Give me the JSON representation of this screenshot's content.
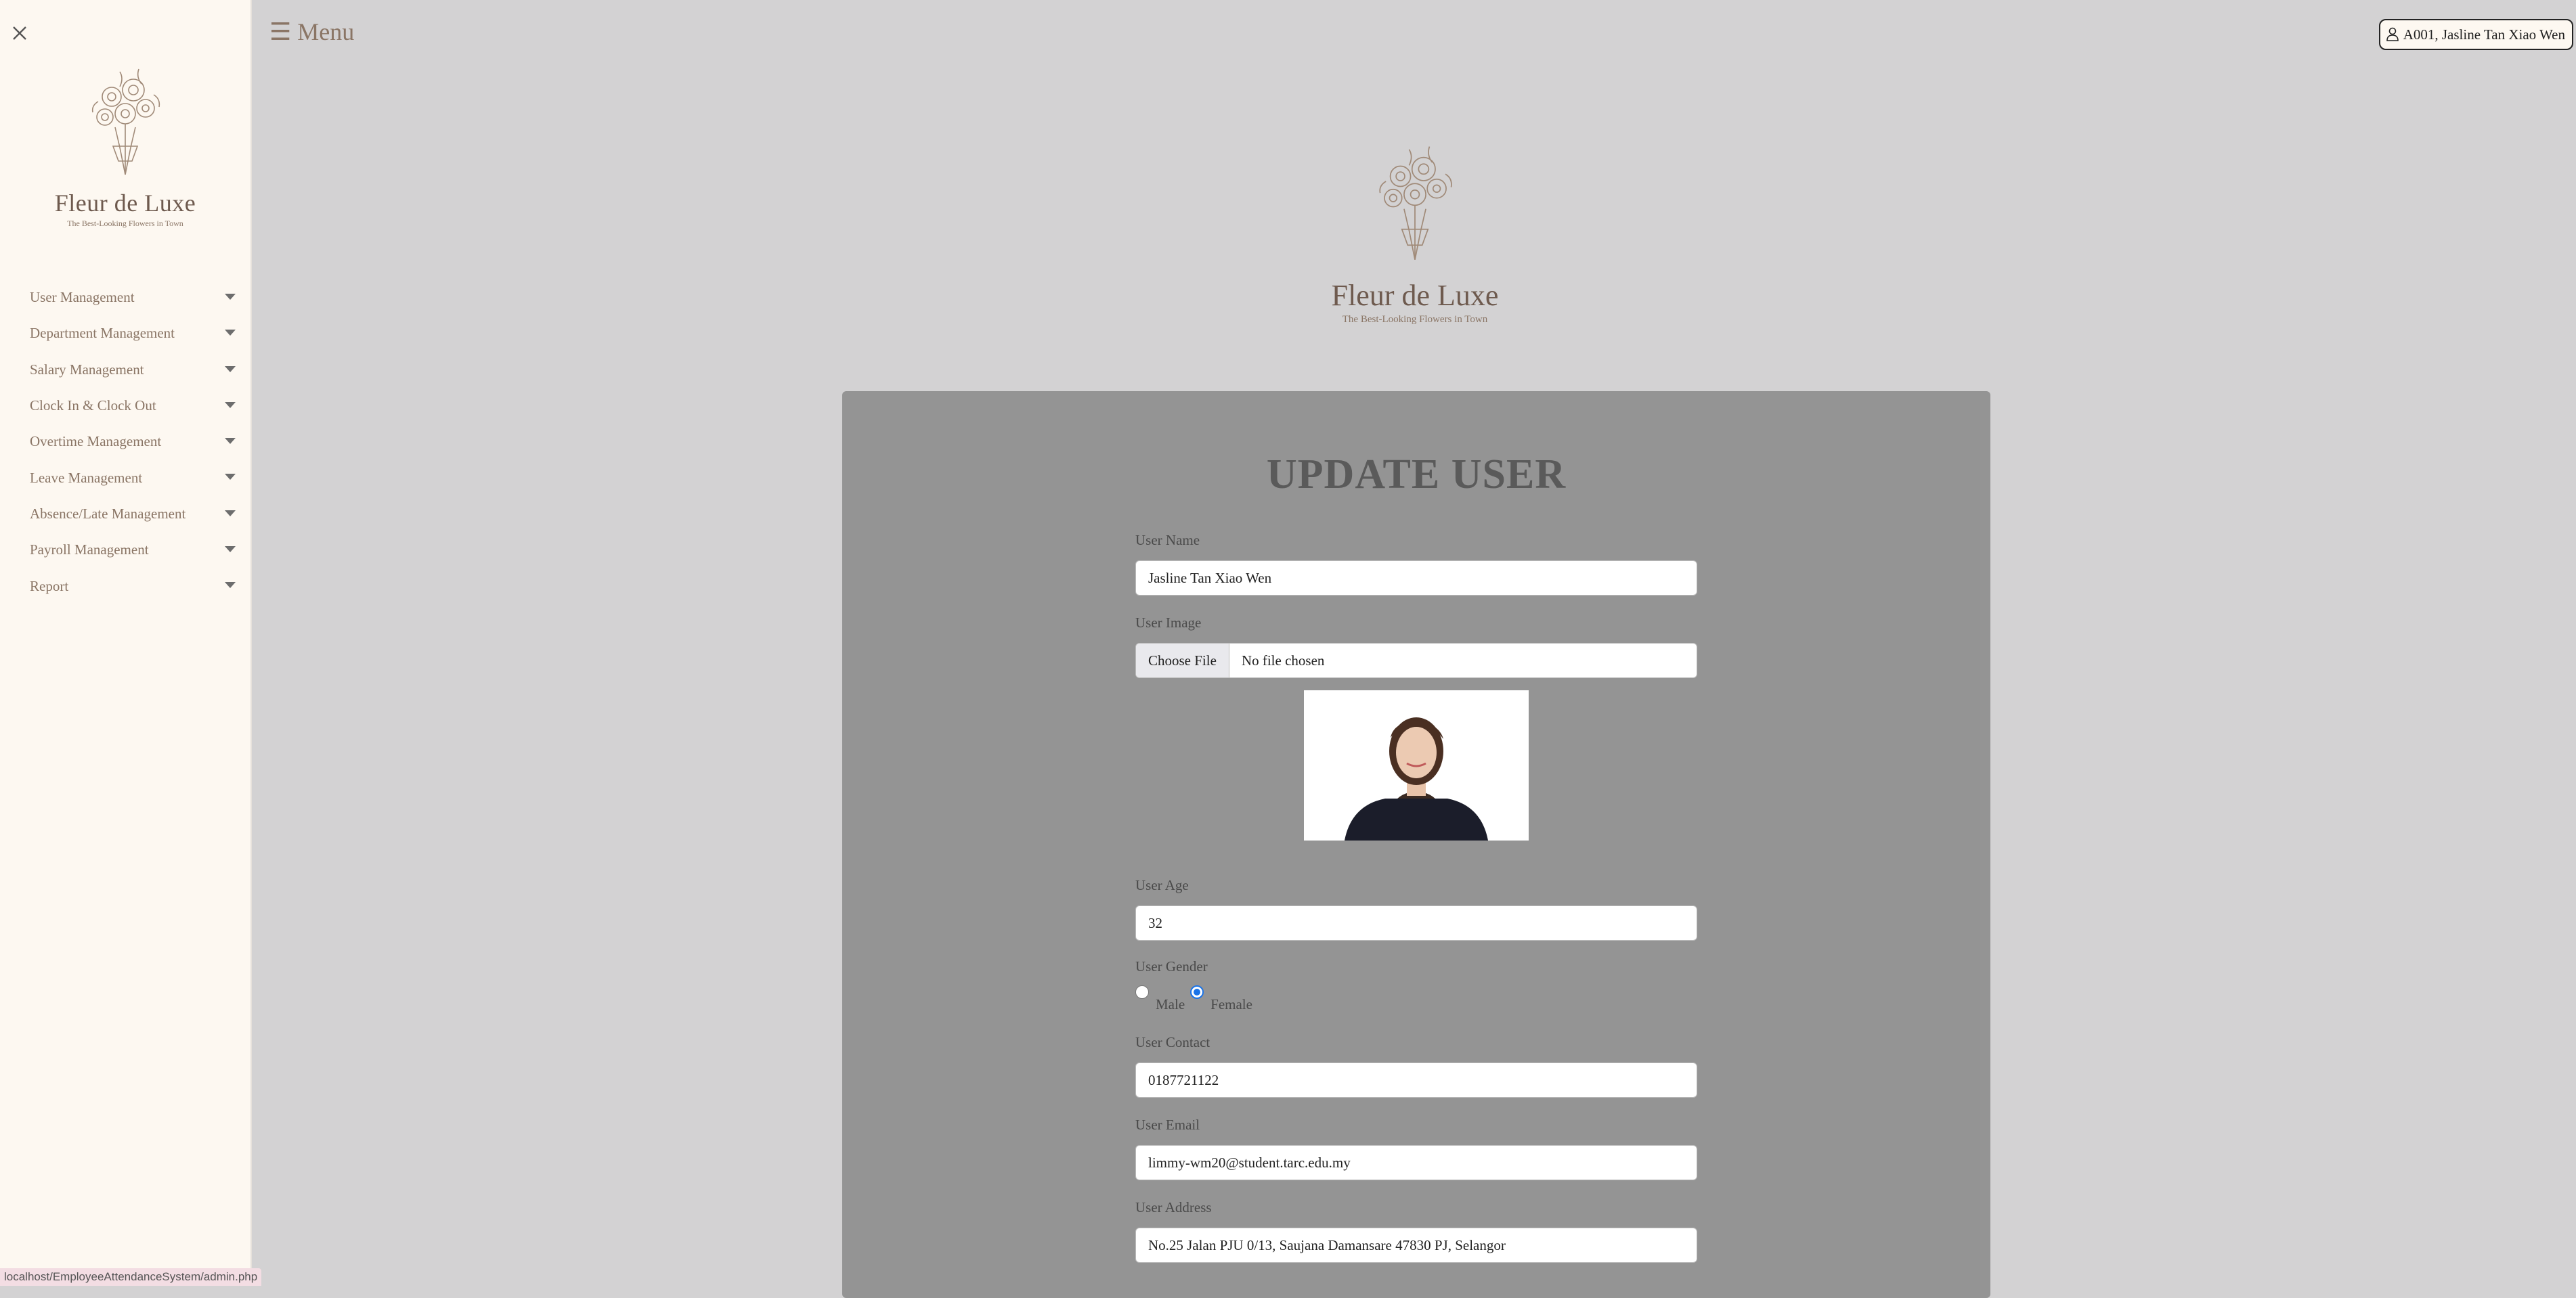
{
  "sidebar": {
    "logo": {
      "brand": "Fleur de Luxe",
      "tagline": "The Best-Looking Flowers in Town"
    },
    "items": [
      {
        "label": "User Management"
      },
      {
        "label": "Department Management"
      },
      {
        "label": "Salary Management"
      },
      {
        "label": "Clock In & Clock Out"
      },
      {
        "label": "Overtime Management"
      },
      {
        "label": "Leave Management"
      },
      {
        "label": "Absence/Late Management"
      },
      {
        "label": "Payroll Management"
      },
      {
        "label": "Report"
      }
    ]
  },
  "header": {
    "menu_label": "☰ Menu",
    "user_badge": "A001, Jasline Tan Xiao Wen"
  },
  "main_logo": {
    "brand": "Fleur de Luxe",
    "tagline": "The Best-Looking Flowers in Town"
  },
  "form": {
    "title": "UPDATE USER",
    "user_name": {
      "label": "User Name",
      "value": "Jasline Tan Xiao Wen"
    },
    "user_image": {
      "label": "User Image",
      "button": "Choose File",
      "status": "No file chosen"
    },
    "user_age": {
      "label": "User Age",
      "value": "32"
    },
    "user_gender": {
      "label": "User Gender",
      "options": [
        "Male",
        "Female"
      ],
      "selected": "Female"
    },
    "user_contact": {
      "label": "User Contact",
      "value": "0187721122"
    },
    "user_email": {
      "label": "User Email",
      "value": "limmy-wm20@student.tarc.edu.my"
    },
    "user_address": {
      "label": "User Address",
      "value": "No.25 Jalan PJU 0/13, Saujana Damansare 47830 PJ, Selangor"
    }
  },
  "status_bar": {
    "url": "localhost/EmployeeAttendanceSystem/admin.php"
  },
  "colors": {
    "sidebar_bg": "#fdf8f1",
    "page_bg": "#d3d2d3",
    "panel_bg": "#949494",
    "radio_accent": "#1a73e8"
  }
}
